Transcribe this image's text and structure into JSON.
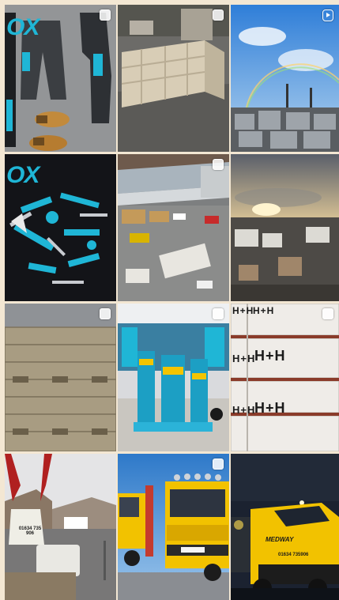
{
  "grid": {
    "posts": [
      {
        "id": 1,
        "subject": "OX workwear flat lay",
        "type": "multiple"
      },
      {
        "id": 2,
        "subject": "timber frame in yard",
        "type": "multiple"
      },
      {
        "id": 3,
        "subject": "merchant yard with rainbow",
        "type": "reel"
      },
      {
        "id": 4,
        "subject": "OX tools layout",
        "type": "single"
      },
      {
        "id": 5,
        "subject": "aerial branch view",
        "type": "multiple"
      },
      {
        "id": 6,
        "subject": "sunset over yard",
        "type": "single"
      },
      {
        "id": 7,
        "subject": "stacked timber pallets",
        "type": "multiple"
      },
      {
        "id": 8,
        "subject": "OX tools store display",
        "type": "multiple"
      },
      {
        "id": 9,
        "subject": "H+H block pallets",
        "type": "multiple"
      },
      {
        "id": 10,
        "subject": "crane lifting bulk bag",
        "type": "single"
      },
      {
        "id": 11,
        "subject": "yellow Scania delivery trucks",
        "type": "multiple"
      },
      {
        "id": 12,
        "subject": "Medway truck at night",
        "type": "single"
      }
    ],
    "labels": {
      "ox_brand_1": "OX",
      "ox_brand_2": "OX",
      "hh_1": "H+H",
      "hh_2": "H+H",
      "hh_3": "H+H",
      "hh_4": "H+H",
      "hh_5": "H+H",
      "hh_6": "H+H",
      "truck_brand": "MEDWAY",
      "truck_phone": "01634 735906",
      "bag_phone": "01634 735 906"
    }
  },
  "colors": {
    "background": "#f3e7d3",
    "ox_cyan": "#1fb6d6",
    "truck_yellow": "#f2c200"
  }
}
